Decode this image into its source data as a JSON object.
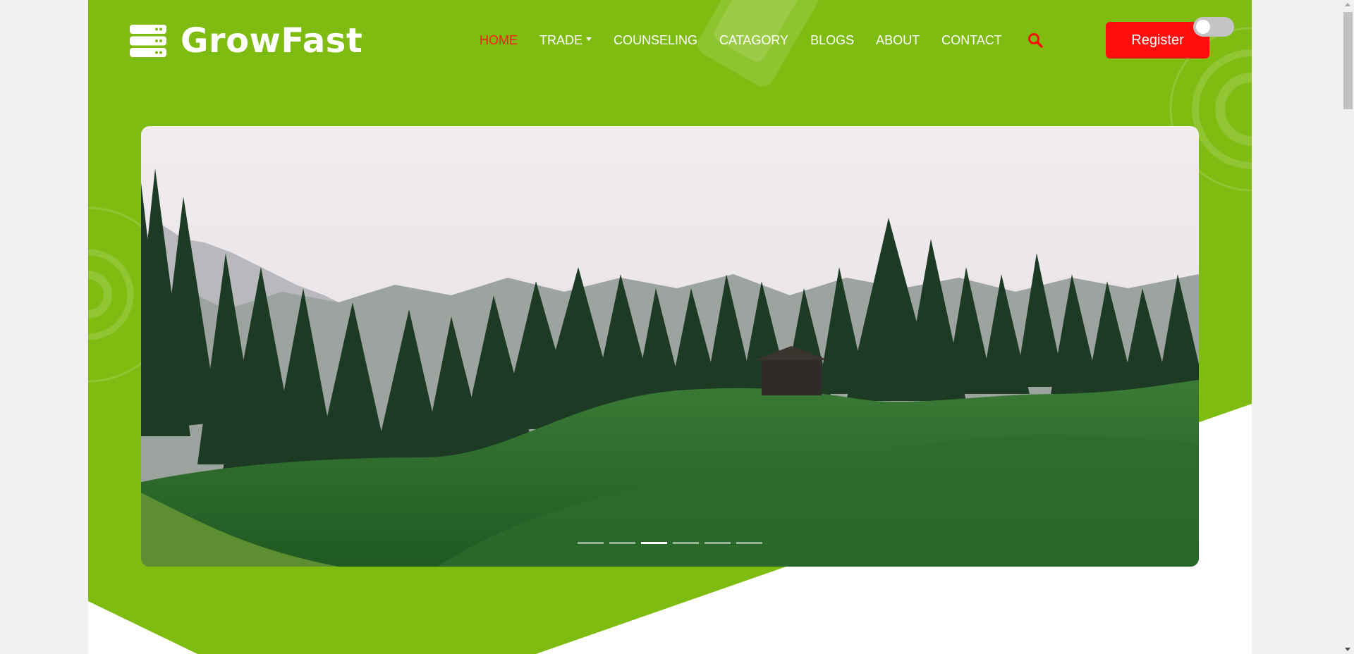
{
  "brand": {
    "name": "GrowFast",
    "logo_icon": "server-stack-icon"
  },
  "nav": {
    "items": [
      {
        "label": "HOME",
        "active": true
      },
      {
        "label": "TRADE",
        "has_dropdown": true
      },
      {
        "label": "COUNSELING"
      },
      {
        "label": "CATAGORY"
      },
      {
        "label": "BLOGS"
      },
      {
        "label": "ABOUT"
      },
      {
        "label": "CONTACT"
      }
    ],
    "search_icon": "search-icon"
  },
  "register_label": "Register",
  "theme_toggle": {
    "state": "off",
    "icon": "toggle-switch"
  },
  "carousel": {
    "image_description": "foggy pine forest with green rolling hills and a small wooden hut",
    "slide_count": 6,
    "active_slide_index": 2
  },
  "colors": {
    "hero_green": "#7fbc12",
    "accent_red": "#ff0d0d",
    "nav_text": "#ffffff"
  }
}
